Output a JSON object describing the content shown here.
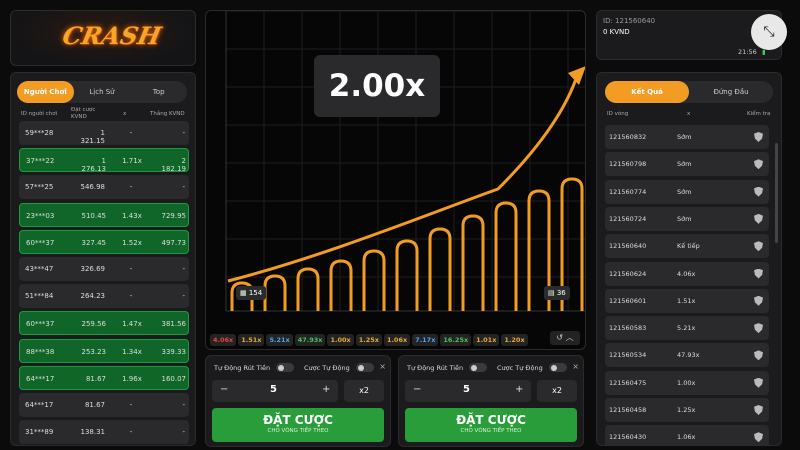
{
  "logo": {
    "text": "CRASH"
  },
  "left": {
    "tabs": [
      "Người Chơi",
      "Lịch Sử",
      "Top"
    ],
    "headers": {
      "player": "ID người chơi",
      "bet": "Đặt cược KVND",
      "x": "x",
      "win": "Thắng KVND"
    },
    "rows": [
      {
        "id": "59***28",
        "bet": "1 321.15",
        "x": "-",
        "win": "-",
        "state": "grey"
      },
      {
        "id": "37***22",
        "bet": "1 276.13",
        "x": "1.71x",
        "win": "2 182.19",
        "state": "green"
      },
      {
        "id": "57***25",
        "bet": "546.98",
        "x": "-",
        "win": "-",
        "state": "grey"
      },
      {
        "id": "23***03",
        "bet": "510.45",
        "x": "1.43x",
        "win": "729.95",
        "state": "green"
      },
      {
        "id": "60***37",
        "bet": "327.45",
        "x": "1.52x",
        "win": "497.73",
        "state": "green"
      },
      {
        "id": "43***47",
        "bet": "326.69",
        "x": "-",
        "win": "-",
        "state": "grey"
      },
      {
        "id": "51***84",
        "bet": "264.23",
        "x": "-",
        "win": "-",
        "state": "grey"
      },
      {
        "id": "60***37",
        "bet": "259.56",
        "x": "1.47x",
        "win": "381.56",
        "state": "green"
      },
      {
        "id": "88***38",
        "bet": "253.23",
        "x": "1.34x",
        "win": "339.33",
        "state": "green"
      },
      {
        "id": "64***17",
        "bet": "81.67",
        "x": "1.96x",
        "win": "160.07",
        "state": "green"
      },
      {
        "id": "64***17",
        "bet": "81.67",
        "x": "-",
        "win": "-",
        "state": "grey"
      },
      {
        "id": "31***89",
        "bet": "138.31",
        "x": "-",
        "win": "-",
        "state": "grey"
      }
    ]
  },
  "game": {
    "multiplier": "2.00x",
    "players_count": "154",
    "bets_count": "36",
    "history": [
      {
        "v": "4.06x",
        "c": "#e0453a"
      },
      {
        "v": "1.51x",
        "c": "#e6a93b"
      },
      {
        "v": "5.21x",
        "c": "#4aa3f0"
      },
      {
        "v": "47.93x",
        "c": "#48c25a"
      },
      {
        "v": "1.00x",
        "c": "#e6a93b"
      },
      {
        "v": "1.25x",
        "c": "#e6a93b"
      },
      {
        "v": "1.06x",
        "c": "#e6a93b"
      },
      {
        "v": "7.17x",
        "c": "#4aa3f0"
      },
      {
        "v": "16.25x",
        "c": "#48c25a"
      },
      {
        "v": "1.01x",
        "c": "#e6a93b"
      },
      {
        "v": "1.20x",
        "c": "#e6a93b"
      }
    ],
    "accent": "#f29c23"
  },
  "betpanels": [
    {
      "auto_cashout": "Tự Động Rút Tiền",
      "auto_bet": "Cược Tự Động",
      "amount": "5",
      "minus": "−",
      "plus": "+",
      "x2": "x2",
      "bet_label": "ĐẶT CƯỢC",
      "bet_sub": "CHO VÒNG TIẾP THEO",
      "close": "×"
    },
    {
      "auto_cashout": "Tự Động Rút Tiền",
      "auto_bet": "Cược Tự Động",
      "amount": "5",
      "minus": "−",
      "plus": "+",
      "x2": "x2",
      "bet_label": "ĐẶT CƯỢC",
      "bet_sub": "CHO VÒNG TIẾP THEO",
      "close": "×"
    }
  ],
  "account": {
    "id": "ID: 121560640",
    "balance": "0 KVND",
    "time": "21:56"
  },
  "right": {
    "tabs": [
      "Kết Quả",
      "Đứng Đầu"
    ],
    "headers": {
      "round": "ID vòng",
      "x": "x",
      "verify": "Kiểm tra"
    },
    "rows": [
      {
        "id": "121560832",
        "x": "Sớm"
      },
      {
        "id": "121560798",
        "x": "Sớm"
      },
      {
        "id": "121560774",
        "x": "Sớm"
      },
      {
        "id": "121560724",
        "x": "Sớm"
      },
      {
        "id": "121560640",
        "x": "Kế tiếp"
      },
      {
        "id": "121560624",
        "x": "4.06x"
      },
      {
        "id": "121560601",
        "x": "1.51x"
      },
      {
        "id": "121560583",
        "x": "5.21x"
      },
      {
        "id": "121560534",
        "x": "47.93x"
      },
      {
        "id": "121560475",
        "x": "1.00x"
      },
      {
        "id": "121560458",
        "x": "1.25x"
      },
      {
        "id": "121560430",
        "x": "1.06x"
      }
    ]
  }
}
